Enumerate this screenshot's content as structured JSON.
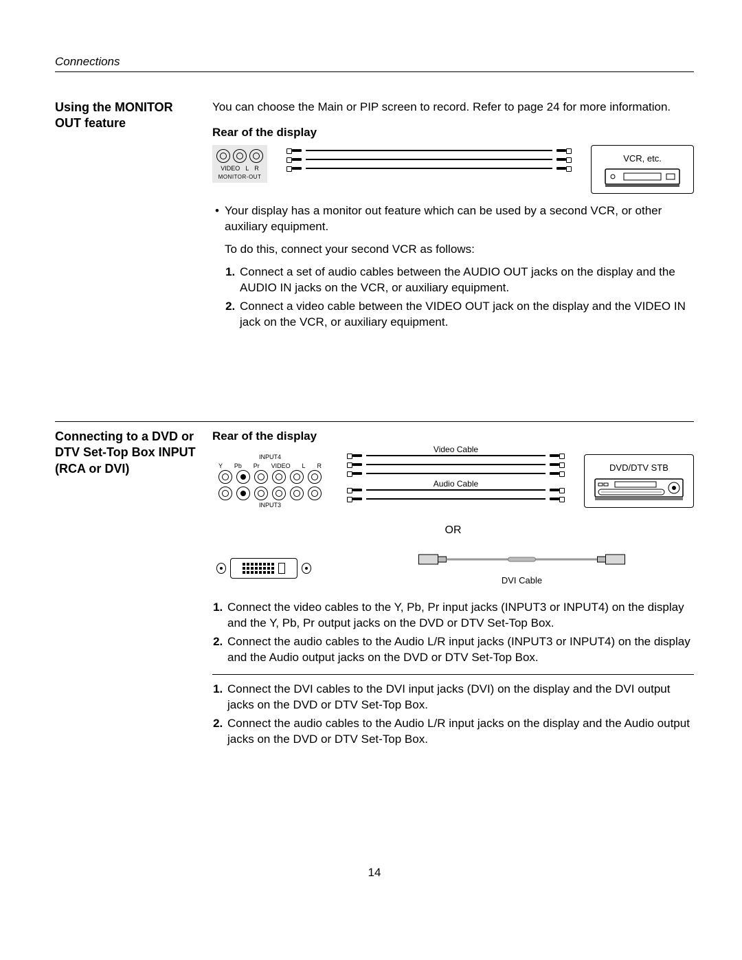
{
  "header": {
    "section_title": "Connections"
  },
  "page_number": "14",
  "section1": {
    "heading": "Using the MONITOR OUT feature",
    "intro": "You can choose the Main or PIP screen to record. Refer to page 24 for more information.",
    "rear_label": "Rear of the display",
    "monitor_out": {
      "labels": [
        "VIDEO",
        "L",
        "R"
      ],
      "title": "MONITOR-OUT"
    },
    "device_label": "VCR, etc.",
    "bullet": "Your display has a monitor out feature which can be used by a second VCR, or other auxiliary equipment.",
    "todo_line": "To do this, connect your second VCR as follows:",
    "steps": [
      "Connect a set of audio cables between the AUDIO OUT jacks on the display and the AUDIO IN jacks on the VCR, or auxiliary equipment.",
      "Connect a video cable between the VIDEO OUT jack on the display and the VIDEO IN jack on the VCR, or auxiliary equipment."
    ]
  },
  "section2": {
    "heading": "Connecting to a DVD or DTV Set-Top Box INPUT (RCA or DVI)",
    "rear_label": "Rear of the display",
    "input4_title": "INPUT4",
    "input3_title": "INPUT3",
    "input_labels": [
      "Y",
      "Pb",
      "Pr",
      "VIDEO",
      "L",
      "R"
    ],
    "video_cable_label": "Video Cable",
    "audio_cable_label": "Audio Cable",
    "or_label": "OR",
    "dvi_cable_label": "DVI Cable",
    "device_label": "DVD/DTV STB",
    "steps_rca": [
      "Connect the video cables to the Y, Pb, Pr input jacks (INPUT3 or INPUT4) on the display and the Y, Pb, Pr output jacks on the DVD or DTV Set-Top Box.",
      "Connect the audio cables to the Audio L/R input jacks (INPUT3 or INPUT4) on the display and the Audio output jacks on the DVD or DTV Set-Top Box."
    ],
    "steps_dvi": [
      "Connect the DVI cables to the DVI input jacks (DVI) on the display and the DVI output jacks on the DVD or DTV Set-Top Box.",
      "Connect the audio cables to the Audio L/R input jacks on the display and the Audio output jacks on the DVD or DTV Set-Top Box."
    ]
  }
}
